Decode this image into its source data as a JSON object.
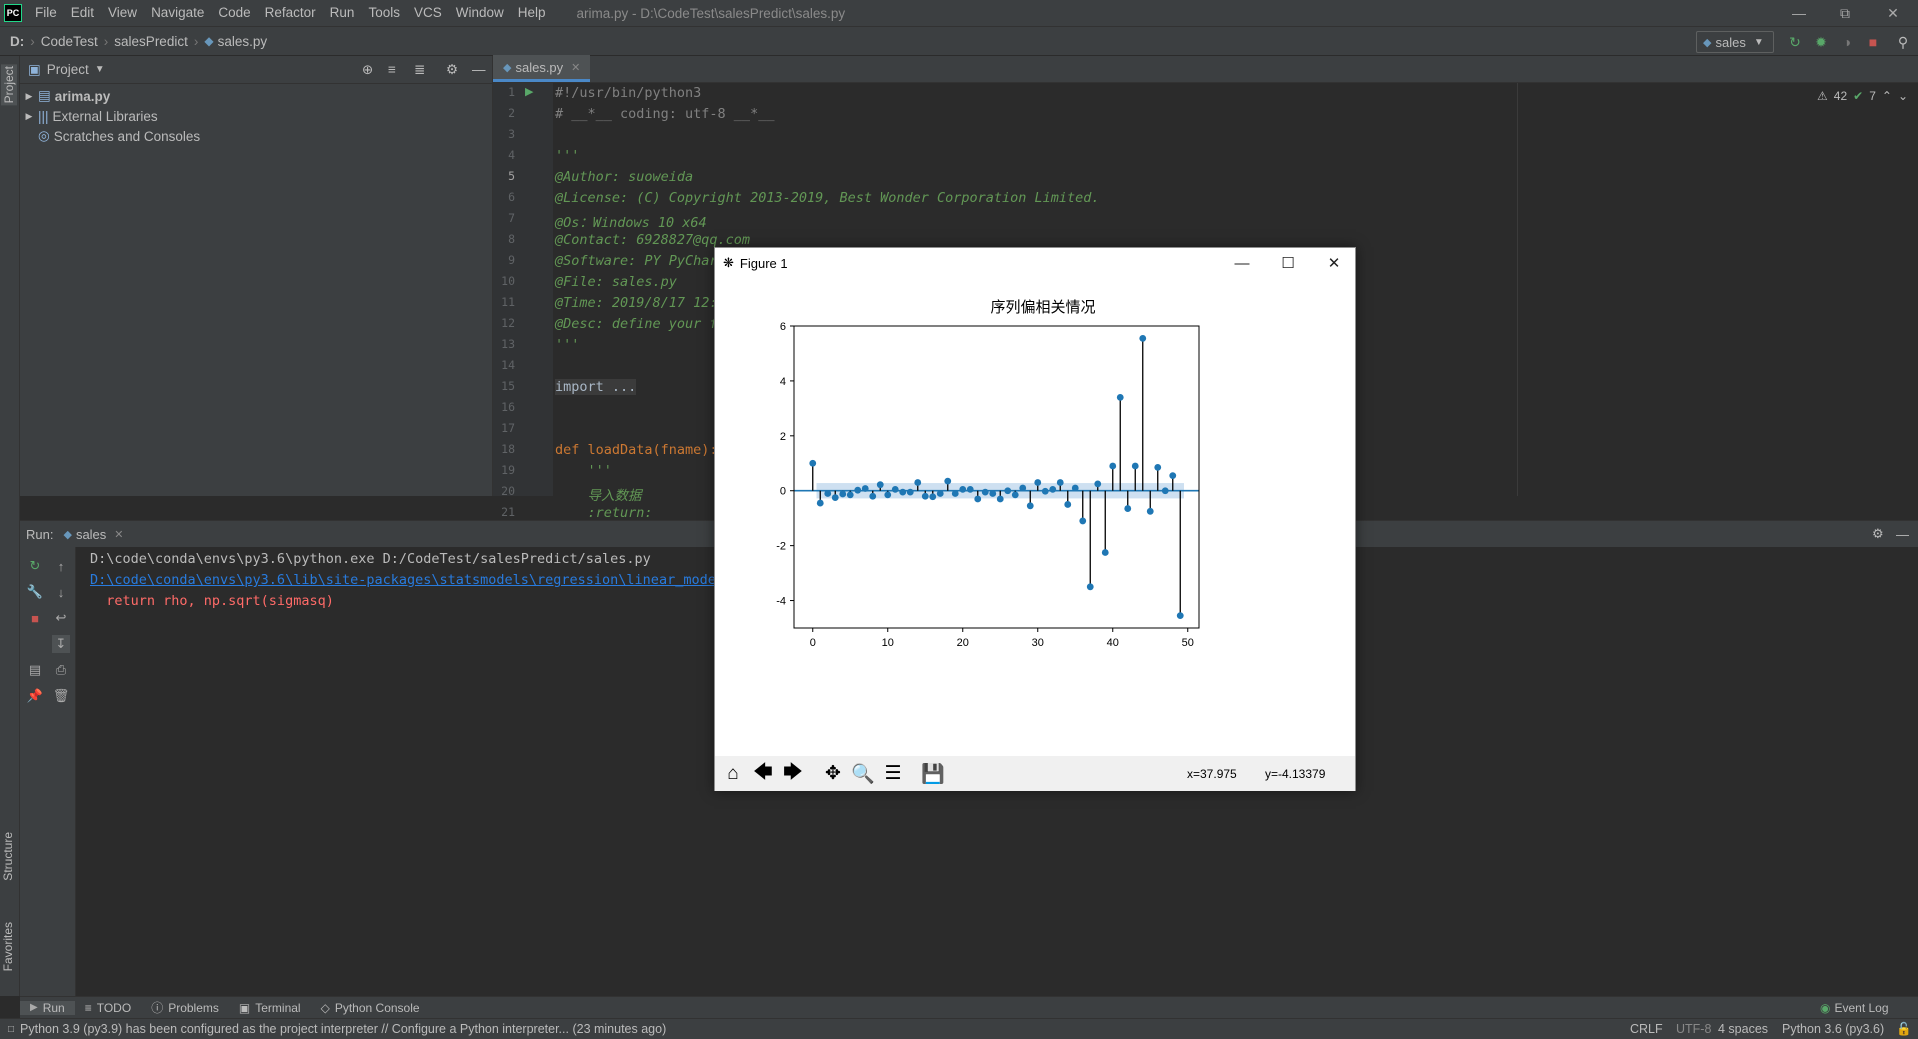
{
  "app": {
    "logo": "PC",
    "window_title": "arima.py - D:\\CodeTest\\salesPredict\\sales.py"
  },
  "menu": [
    "File",
    "Edit",
    "View",
    "Navigate",
    "Code",
    "Refactor",
    "Run",
    "Tools",
    "VCS",
    "Window",
    "Help"
  ],
  "breadcrumb": {
    "drive": "D:",
    "items": [
      "CodeTest",
      "salesPredict",
      "sales.py"
    ]
  },
  "run_config": "sales",
  "project": {
    "title": "Project",
    "items": [
      {
        "label": "arima.py",
        "bold": true
      },
      {
        "label": "External Libraries",
        "bold": false
      },
      {
        "label": "Scratches and Consoles",
        "bold": false
      }
    ]
  },
  "editor": {
    "tab": "sales.py",
    "inspections": {
      "warnings": "42",
      "ok": "7"
    },
    "lines": [
      {
        "n": "1",
        "text": "#!/usr/bin/python3",
        "color": "#808080"
      },
      {
        "n": "2",
        "text": "# __*__ coding: utf-8 __*__",
        "color": "#808080"
      },
      {
        "n": "3",
        "text": "",
        "color": "#808080"
      },
      {
        "n": "4",
        "text": "'''",
        "color": "#629755"
      },
      {
        "n": "5",
        "text": "@Author: suoweida",
        "color": "#629755"
      },
      {
        "n": "6",
        "text": "@License: (C) Copyright 2013-2019, Best Wonder Corporation Limited.",
        "color": "#629755"
      },
      {
        "n": "7",
        "text": "@Os：Windows 10 x64",
        "color": "#629755"
      },
      {
        "n": "8",
        "text": "@Contact: 6928827@qq.com",
        "color": "#629755"
      },
      {
        "n": "9",
        "text": "@Software: PY PyCharm",
        "color": "#629755"
      },
      {
        "n": "10",
        "text": "@File: sales.py",
        "color": "#629755"
      },
      {
        "n": "11",
        "text": "@Time: 2019/8/17 12:",
        "color": "#629755"
      },
      {
        "n": "12",
        "text": "@Desc: define your f",
        "color": "#629755"
      },
      {
        "n": "13",
        "text": "'''",
        "color": "#629755"
      },
      {
        "n": "14",
        "text": "",
        "color": "#808080"
      },
      {
        "n": "15",
        "text": "import ...",
        "color": "#a9b7c6"
      },
      {
        "n": "16",
        "text": "",
        "color": "#808080"
      },
      {
        "n": "17",
        "text": "",
        "color": "#808080"
      },
      {
        "n": "18",
        "text": "def loadData(fname):",
        "color": "#cc7832"
      },
      {
        "n": "19",
        "text": "    '''",
        "color": "#629755"
      },
      {
        "n": "20",
        "text": "    导入数据",
        "color": "#629755"
      },
      {
        "n": "21",
        "text": "    :return:",
        "color": "#629755"
      }
    ]
  },
  "run": {
    "label": "Run:",
    "tab": "sales",
    "lines": [
      {
        "text": "D:\\code\\conda\\envs\\py3.6\\python.exe D:/CodeTest/salesPredict/sales.py",
        "color": "#bbbbbb"
      },
      {
        "text": "D:\\code\\conda\\envs\\py3.6\\lib\\site-packages\\statsmodels\\regression\\linear_model",
        "color": "#287bde"
      },
      {
        "text": "  return rho, np.sqrt(sigmasq)",
        "color": "#ff6b68"
      }
    ]
  },
  "left_tabs": {
    "project": "Project",
    "structure": "Structure",
    "favorites": "Favorites"
  },
  "bottom_tabs": [
    "Run",
    "TODO",
    "Problems",
    "Terminal",
    "Python Console"
  ],
  "event_log": "Event Log",
  "status": {
    "message": "Python 3.9 (py3.9) has been configured as the project interpreter // Configure a Python interpreter... (23 minutes ago)",
    "line_sep": "CRLF",
    "encoding": "UTF-8",
    "indent": "4 spaces",
    "interpreter": "Python 3.6 (py3.6)"
  },
  "figure": {
    "window_title": "Figure 1",
    "coords": {
      "x": "x=37.975",
      "y": "y=-4.13379"
    },
    "colors": {
      "stem": "#000000",
      "marker": "#1f77b4",
      "band": "#c6dbef"
    }
  },
  "chart_data": {
    "type": "stem",
    "title": "序列偏相关情况",
    "xlabel": "",
    "ylabel": "",
    "xlim": [
      -2.5,
      51.5
    ],
    "ylim": [
      -5,
      6
    ],
    "xticks": [
      0,
      10,
      20,
      30,
      40,
      50
    ],
    "yticks": [
      -4,
      -2,
      0,
      2,
      4,
      6
    ],
    "confidence_band": [
      -0.28,
      0.28
    ],
    "x": [
      0,
      1,
      2,
      3,
      4,
      5,
      6,
      7,
      8,
      9,
      10,
      11,
      12,
      13,
      14,
      15,
      16,
      17,
      18,
      19,
      20,
      21,
      22,
      23,
      24,
      25,
      26,
      27,
      28,
      29,
      30,
      31,
      32,
      33,
      34,
      35,
      36,
      37,
      38,
      39,
      40,
      41,
      42,
      43,
      44,
      45,
      46,
      47,
      48,
      49
    ],
    "values": [
      1.0,
      -0.45,
      -0.1,
      -0.25,
      -0.12,
      -0.15,
      0.02,
      0.08,
      -0.2,
      0.22,
      -0.15,
      0.05,
      -0.05,
      -0.05,
      0.3,
      -0.2,
      -0.22,
      -0.1,
      0.35,
      -0.1,
      0.05,
      0.05,
      -0.3,
      -0.05,
      -0.1,
      -0.3,
      0.0,
      -0.15,
      0.1,
      -0.55,
      0.3,
      -0.02,
      0.05,
      0.3,
      -0.5,
      0.1,
      -1.1,
      -3.5,
      0.25,
      -2.25,
      0.9,
      3.4,
      -0.65,
      0.9,
      5.55,
      -0.75,
      0.85,
      0.0,
      0.55,
      -4.55
    ]
  }
}
